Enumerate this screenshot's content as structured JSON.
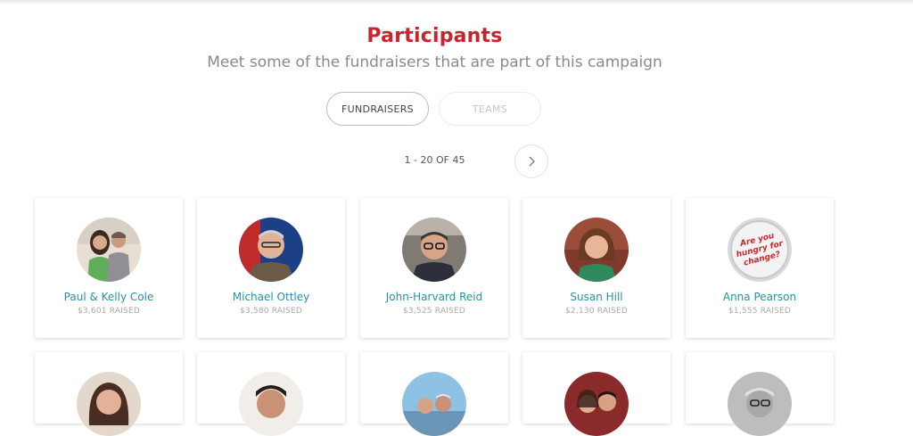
{
  "header": {
    "title": "Participants",
    "subtitle": "Meet some of the fundraisers that are part of this campaign"
  },
  "tabs": [
    {
      "label": "FUNDRAISERS",
      "active": true
    },
    {
      "label": "TEAMS",
      "active": false
    }
  ],
  "pagination": {
    "label": "1 - 20 OF 45",
    "next_icon": "chevron-right-icon"
  },
  "participants": [
    {
      "name": "Paul & Kelly Cole",
      "raised": "$3,601 RAISED"
    },
    {
      "name": "Michael Ottley",
      "raised": "$3,580 RAISED"
    },
    {
      "name": "John-Harvard Reid",
      "raised": "$3,525 RAISED"
    },
    {
      "name": "Susan Hill",
      "raised": "$2,130 RAISED"
    },
    {
      "name": "Anna Pearson",
      "raised": "$1,555 RAISED"
    }
  ],
  "avatar_badge_text": "Are you hungry for change?",
  "colors": {
    "accent": "#c9242b",
    "name_link": "#2a8fa6",
    "muted": "#8a8a8a"
  }
}
